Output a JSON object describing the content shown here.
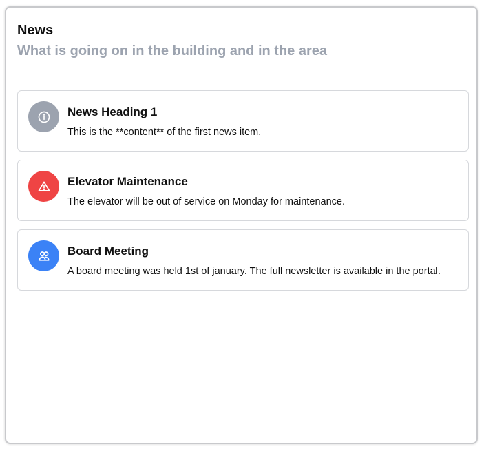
{
  "header": {
    "title": "News",
    "subtitle": "What is going on in the building and in the area"
  },
  "news": [
    {
      "heading": "News Heading 1",
      "content": "This is the **content** of the first news item.",
      "icon": "info-icon",
      "color": "#9ca3af"
    },
    {
      "heading": "Elevator Maintenance",
      "content": "The elevator will be out of service on Monday for maintenance.",
      "icon": "warning-icon",
      "color": "#ef4444"
    },
    {
      "heading": "Board Meeting",
      "content": "A board meeting was held 1st of january. The full newsletter is available in the portal.",
      "icon": "users-icon",
      "color": "#3b82f6"
    }
  ]
}
